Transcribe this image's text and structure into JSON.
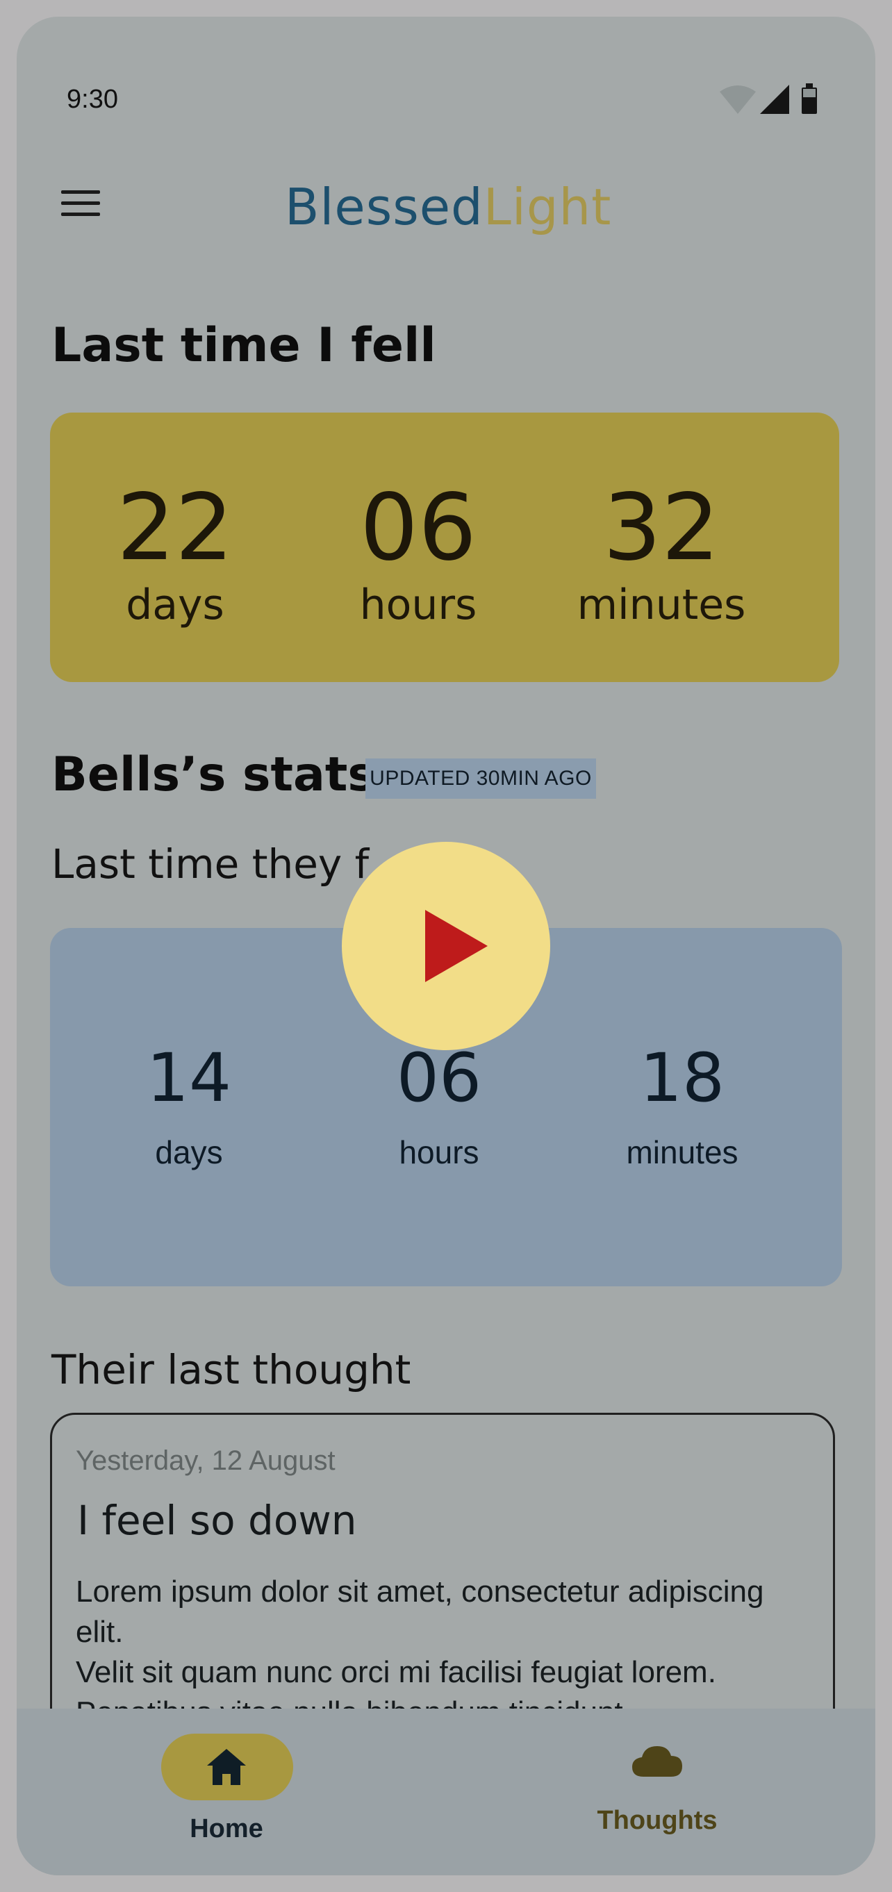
{
  "status_bar": {
    "time": "9:30"
  },
  "app_bar": {
    "logo_part1": "Blessed",
    "logo_part2": "Light"
  },
  "my_section": {
    "title": "Last time I fell",
    "counter": [
      {
        "value": "22",
        "unit": "days"
      },
      {
        "value": "06",
        "unit": "hours"
      },
      {
        "value": "32",
        "unit": "minutes"
      }
    ]
  },
  "stats_section": {
    "title": "Bells’s stats",
    "badge": "UPDATED 30MIN AGO",
    "subtitle": "Last time they f",
    "counter": [
      {
        "value": "14",
        "unit": "days"
      },
      {
        "value": "06",
        "unit": "hours"
      },
      {
        "value": "18",
        "unit": "minutes"
      }
    ]
  },
  "thought_section": {
    "title": "Their last thought",
    "date": "Yesterday, 12 August",
    "heading": "I feel so down",
    "body": "Lorem ipsum dolor sit amet, consectetur adipiscing elit.\nVelit sit quam nunc orci mi facilisi feugiat lorem. Penatibus vitae nulla bibendum tincidunt"
  },
  "bottom_nav": {
    "items": [
      {
        "label": "Home",
        "icon": "home-icon",
        "active": true
      },
      {
        "label": "Thoughts",
        "icon": "cloud-icon",
        "active": false
      }
    ]
  },
  "colors": {
    "background": "#a4a9a9",
    "accent_gold": "#a89840",
    "accent_blue": "#8799ab",
    "play_bg": "#f2dd88",
    "play_icon": "#be1b1b"
  }
}
